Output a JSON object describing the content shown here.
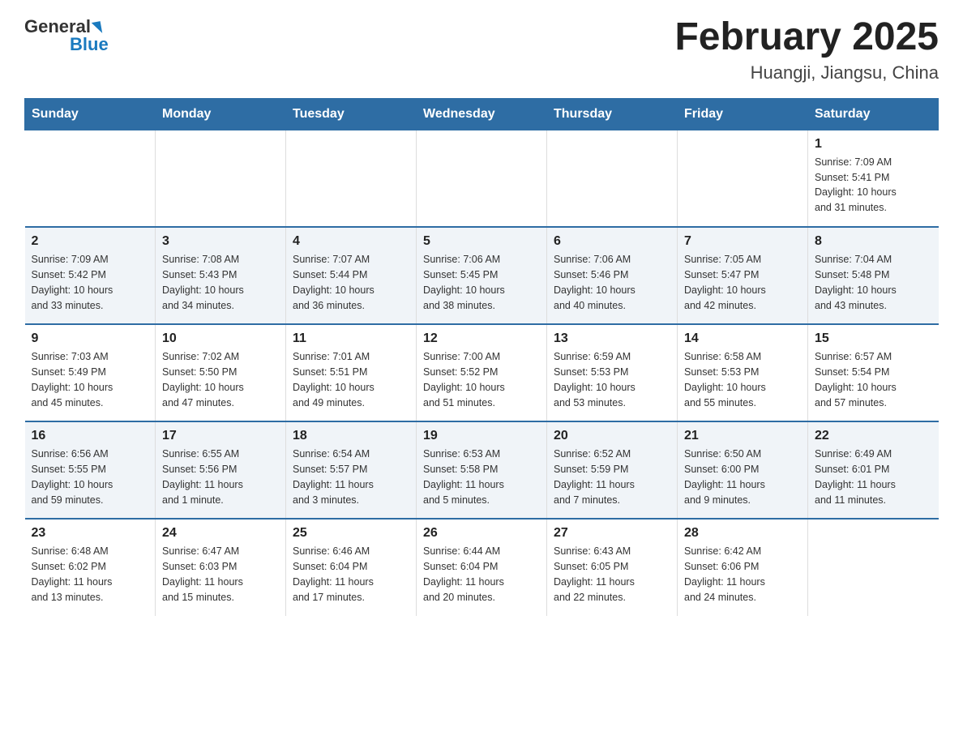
{
  "header": {
    "logo_general": "General",
    "logo_blue": "Blue",
    "title": "February 2025",
    "subtitle": "Huangji, Jiangsu, China"
  },
  "days_of_week": [
    "Sunday",
    "Monday",
    "Tuesday",
    "Wednesday",
    "Thursday",
    "Friday",
    "Saturday"
  ],
  "weeks": [
    [
      {
        "day": "",
        "info": ""
      },
      {
        "day": "",
        "info": ""
      },
      {
        "day": "",
        "info": ""
      },
      {
        "day": "",
        "info": ""
      },
      {
        "day": "",
        "info": ""
      },
      {
        "day": "",
        "info": ""
      },
      {
        "day": "1",
        "info": "Sunrise: 7:09 AM\nSunset: 5:41 PM\nDaylight: 10 hours\nand 31 minutes."
      }
    ],
    [
      {
        "day": "2",
        "info": "Sunrise: 7:09 AM\nSunset: 5:42 PM\nDaylight: 10 hours\nand 33 minutes."
      },
      {
        "day": "3",
        "info": "Sunrise: 7:08 AM\nSunset: 5:43 PM\nDaylight: 10 hours\nand 34 minutes."
      },
      {
        "day": "4",
        "info": "Sunrise: 7:07 AM\nSunset: 5:44 PM\nDaylight: 10 hours\nand 36 minutes."
      },
      {
        "day": "5",
        "info": "Sunrise: 7:06 AM\nSunset: 5:45 PM\nDaylight: 10 hours\nand 38 minutes."
      },
      {
        "day": "6",
        "info": "Sunrise: 7:06 AM\nSunset: 5:46 PM\nDaylight: 10 hours\nand 40 minutes."
      },
      {
        "day": "7",
        "info": "Sunrise: 7:05 AM\nSunset: 5:47 PM\nDaylight: 10 hours\nand 42 minutes."
      },
      {
        "day": "8",
        "info": "Sunrise: 7:04 AM\nSunset: 5:48 PM\nDaylight: 10 hours\nand 43 minutes."
      }
    ],
    [
      {
        "day": "9",
        "info": "Sunrise: 7:03 AM\nSunset: 5:49 PM\nDaylight: 10 hours\nand 45 minutes."
      },
      {
        "day": "10",
        "info": "Sunrise: 7:02 AM\nSunset: 5:50 PM\nDaylight: 10 hours\nand 47 minutes."
      },
      {
        "day": "11",
        "info": "Sunrise: 7:01 AM\nSunset: 5:51 PM\nDaylight: 10 hours\nand 49 minutes."
      },
      {
        "day": "12",
        "info": "Sunrise: 7:00 AM\nSunset: 5:52 PM\nDaylight: 10 hours\nand 51 minutes."
      },
      {
        "day": "13",
        "info": "Sunrise: 6:59 AM\nSunset: 5:53 PM\nDaylight: 10 hours\nand 53 minutes."
      },
      {
        "day": "14",
        "info": "Sunrise: 6:58 AM\nSunset: 5:53 PM\nDaylight: 10 hours\nand 55 minutes."
      },
      {
        "day": "15",
        "info": "Sunrise: 6:57 AM\nSunset: 5:54 PM\nDaylight: 10 hours\nand 57 minutes."
      }
    ],
    [
      {
        "day": "16",
        "info": "Sunrise: 6:56 AM\nSunset: 5:55 PM\nDaylight: 10 hours\nand 59 minutes."
      },
      {
        "day": "17",
        "info": "Sunrise: 6:55 AM\nSunset: 5:56 PM\nDaylight: 11 hours\nand 1 minute."
      },
      {
        "day": "18",
        "info": "Sunrise: 6:54 AM\nSunset: 5:57 PM\nDaylight: 11 hours\nand 3 minutes."
      },
      {
        "day": "19",
        "info": "Sunrise: 6:53 AM\nSunset: 5:58 PM\nDaylight: 11 hours\nand 5 minutes."
      },
      {
        "day": "20",
        "info": "Sunrise: 6:52 AM\nSunset: 5:59 PM\nDaylight: 11 hours\nand 7 minutes."
      },
      {
        "day": "21",
        "info": "Sunrise: 6:50 AM\nSunset: 6:00 PM\nDaylight: 11 hours\nand 9 minutes."
      },
      {
        "day": "22",
        "info": "Sunrise: 6:49 AM\nSunset: 6:01 PM\nDaylight: 11 hours\nand 11 minutes."
      }
    ],
    [
      {
        "day": "23",
        "info": "Sunrise: 6:48 AM\nSunset: 6:02 PM\nDaylight: 11 hours\nand 13 minutes."
      },
      {
        "day": "24",
        "info": "Sunrise: 6:47 AM\nSunset: 6:03 PM\nDaylight: 11 hours\nand 15 minutes."
      },
      {
        "day": "25",
        "info": "Sunrise: 6:46 AM\nSunset: 6:04 PM\nDaylight: 11 hours\nand 17 minutes."
      },
      {
        "day": "26",
        "info": "Sunrise: 6:44 AM\nSunset: 6:04 PM\nDaylight: 11 hours\nand 20 minutes."
      },
      {
        "day": "27",
        "info": "Sunrise: 6:43 AM\nSunset: 6:05 PM\nDaylight: 11 hours\nand 22 minutes."
      },
      {
        "day": "28",
        "info": "Sunrise: 6:42 AM\nSunset: 6:06 PM\nDaylight: 11 hours\nand 24 minutes."
      },
      {
        "day": "",
        "info": ""
      }
    ]
  ]
}
